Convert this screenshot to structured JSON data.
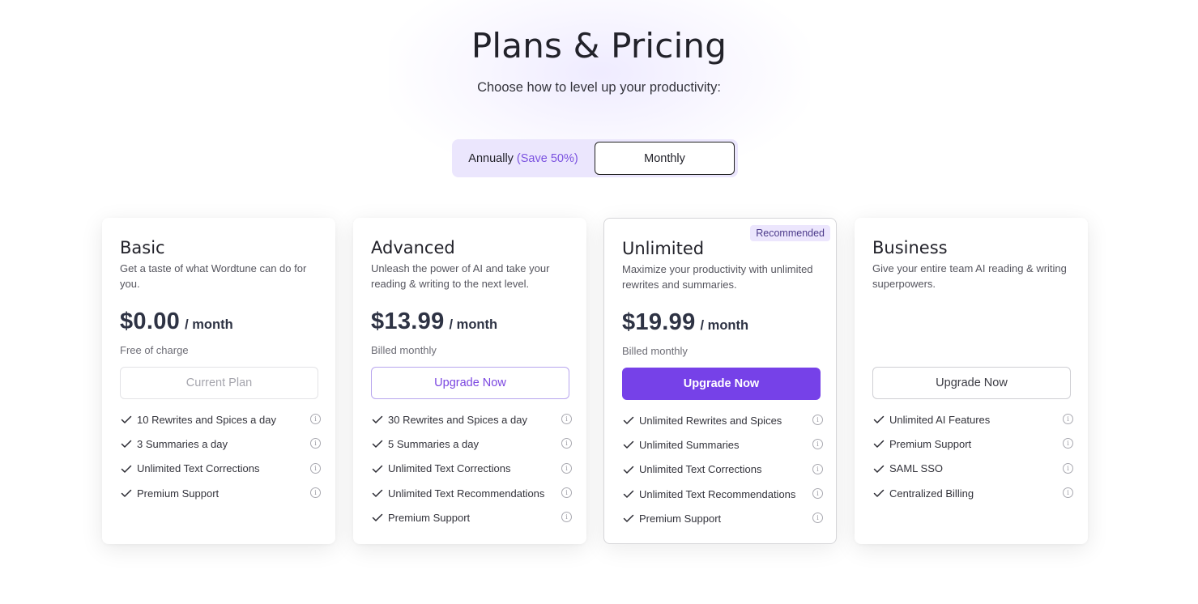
{
  "header": {
    "title": "Plans & Pricing",
    "subtitle": "Choose how to level up your productivity:"
  },
  "billing_toggle": {
    "annual_label": "Annually",
    "annual_savings": "(Save 50%)",
    "monthly_label": "Monthly",
    "selected": "Monthly"
  },
  "colors": {
    "accent": "#7641e8",
    "toggle_bg": "#ebe6fd",
    "savings_text": "#7b52e0"
  },
  "plans": [
    {
      "name": "Basic",
      "description": "Get a taste of what Wordtune can do for you.",
      "price": "$0.00",
      "period": "/ month",
      "billing_note": "Free of charge",
      "button_label": "Current Plan",
      "features": [
        "10 Rewrites and Spices a day",
        "3 Summaries a day",
        "Unlimited Text Corrections",
        "Premium Support"
      ]
    },
    {
      "name": "Advanced",
      "description": "Unleash the power of AI and take your reading & writing to the next level.",
      "price": "$13.99",
      "period": "/ month",
      "billing_note": "Billed monthly",
      "button_label": "Upgrade Now",
      "features": [
        "30 Rewrites and Spices a day",
        "5 Summaries a day",
        "Unlimited Text Corrections",
        "Unlimited Text Recommendations",
        "Premium Support"
      ]
    },
    {
      "name": "Unlimited",
      "badge": "Recommended",
      "description": "Maximize your productivity with unlimited rewrites and summaries.",
      "price": "$19.99",
      "period": "/ month",
      "billing_note": "Billed monthly",
      "button_label": "Upgrade Now",
      "features": [
        "Unlimited Rewrites and Spices",
        "Unlimited Summaries",
        "Unlimited Text Corrections",
        "Unlimited Text Recommendations",
        "Premium Support"
      ]
    },
    {
      "name": "Business",
      "description": "Give your entire team AI reading & writing superpowers.",
      "button_label": "Upgrade Now",
      "features": [
        "Unlimited AI Features",
        "Premium Support",
        "SAML SSO",
        "Centralized Billing"
      ]
    }
  ],
  "icons": {
    "feature_check": "check-icon",
    "feature_info": "info-icon",
    "info_glyph": "i"
  }
}
